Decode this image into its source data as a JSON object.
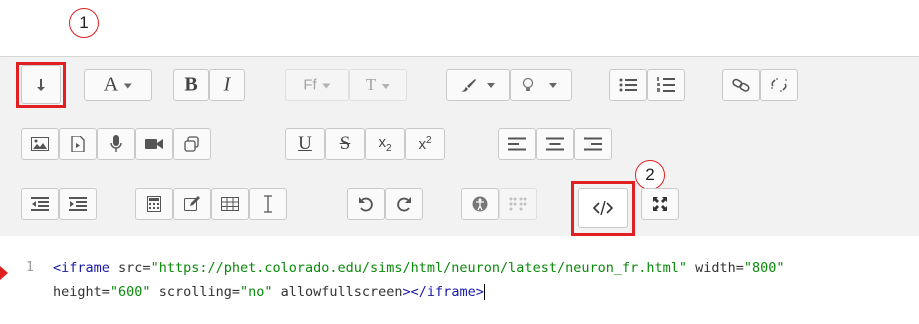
{
  "markers": {
    "one": "1",
    "two": "2"
  },
  "toolbar": {
    "row1": {
      "font_size_label": "A",
      "bold_label": "B",
      "italic_label": "I",
      "font_family_label": "Ff",
      "text_size_label": "T"
    },
    "row2": {
      "underline_label": "U",
      "strike_label": "S",
      "subscript_label": "x",
      "subscript_sub": "2",
      "superscript_label": "x",
      "superscript_sup": "2"
    }
  },
  "editor": {
    "line_number": "1",
    "line1": {
      "tag_open": "<iframe",
      "src_attr": "src=",
      "src_value": "\"https://phet.colorado.edu/sims/html/neuron/latest/neuron_fr.html\"",
      "width_attr": "width=",
      "width_value": "\"800\""
    },
    "line2": {
      "height_attr": "height=",
      "height_value": "\"600\"",
      "scrolling_attr": "scrolling=",
      "scrolling_value": "\"no\"",
      "allowfullscreen": "allowfullscreen",
      "tag_close": "></iframe>"
    }
  }
}
